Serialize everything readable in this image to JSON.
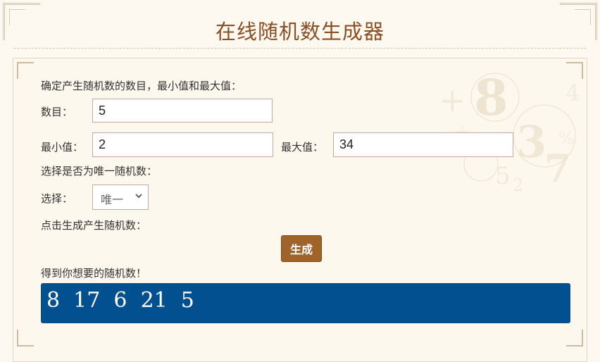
{
  "page": {
    "title": "在线随机数生成器"
  },
  "form": {
    "instruction": "确定产生随机数的数目，最小值和最大值：",
    "count_label": "数目：",
    "count_value": "5",
    "min_label": "最小值：",
    "min_value": "2",
    "max_label": "最大值：",
    "max_value": "34",
    "unique_prompt": "选择是否为唯一随机数：",
    "select_label": "选择：",
    "select_value": "唯一",
    "generate_prompt": "点击生成产生随机数：",
    "generate_button": "生成",
    "result_label": "得到你想要的随机数！",
    "result_value": "8  17  6  21  5"
  },
  "colors": {
    "accent_brown": "#a0632a",
    "title_brown": "#8b4f24",
    "result_blue": "#02508f",
    "background": "#fdf9f0"
  },
  "icons": {
    "select_arrow": "chevron-down-icon",
    "background_art": "number-decoration"
  }
}
